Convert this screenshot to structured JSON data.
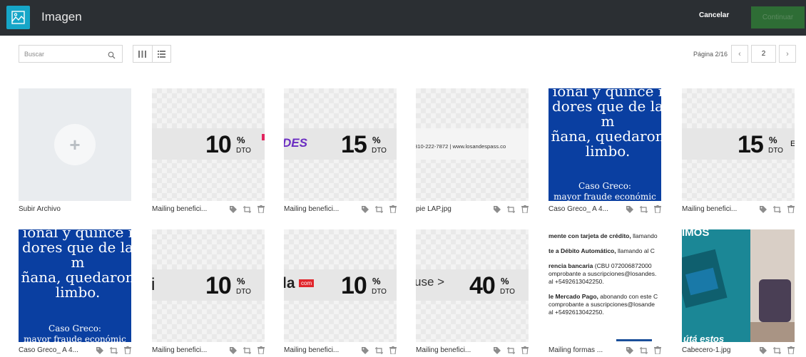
{
  "header": {
    "title": "Imagen",
    "cancel_label": "Cancelar",
    "continue_label": "Continuar",
    "logo_icon": "image-icon"
  },
  "toolbar": {
    "search_placeholder": "Buscar",
    "search_icon": "search-icon",
    "grid_view_icon": "grid-view-icon",
    "list_view_icon": "list-view-icon",
    "pagination_label": "Página 2/16",
    "page_value": "2",
    "prev_icon": "chevron-left-icon",
    "next_icon": "chevron-right-icon"
  },
  "tiles": [
    {
      "filename": "Subir Archivo"
    },
    {
      "filename": "Mailing benefici...",
      "percent": "10"
    },
    {
      "filename": "Mailing benefici...",
      "percent": "15",
      "brand": "DES"
    },
    {
      "filename": "pie LAP.jpg",
      "footer_text": "310-222-7872 | www.losandespass.co"
    },
    {
      "filename": "Caso Greco_ A 4...",
      "poem": [
        "ional y quince i",
        "dores que de la m",
        "ñana, quedaron",
        "limbo."
      ],
      "caption": [
        "Caso Greco:",
        "mayor fraude económic"
      ]
    },
    {
      "filename": "Mailing benefici...",
      "percent": "15"
    },
    {
      "filename": "Caso Greco_ A 4...",
      "poem": [
        "ional y quince i",
        "dores que de la m",
        "ñana, quedaron",
        "limbo."
      ],
      "caption": [
        "Caso Greco:",
        "mayor fraude económic"
      ]
    },
    {
      "filename": "Mailing benefici...",
      "percent": "10",
      "prefix": "i"
    },
    {
      "filename": "Mailing benefici...",
      "percent": "10",
      "brand": "la",
      "badge": "com"
    },
    {
      "filename": "Mailing benefici...",
      "percent": "40",
      "brand": "use >"
    },
    {
      "filename": "Mailing formas ...",
      "info_lines": [
        {
          "bold": "mente con tarjeta de crédito,",
          "rest": " llamando"
        },
        {
          "bold": "te a Débito Automático,",
          "rest": " llamando al C"
        },
        {
          "bold": "rencia bancaria",
          "rest": " (CBU 072006872000"
        },
        {
          "bold": "",
          "rest": "omprobante a suscripciones@losandes."
        },
        {
          "bold": "",
          "rest": "al +5492613042250."
        },
        {
          "bold": "le Mercado Pago,",
          "rest": " abonando con este C"
        },
        {
          "bold": "",
          "rest": "comprobante a suscripciones@losande"
        },
        {
          "bold": "",
          "rest": "al +5492613042250."
        }
      ]
    },
    {
      "filename": "Cabecero-1.jpg",
      "banner_top": "IMOS",
      "banner_bottom": "útá estos"
    }
  ],
  "labels": {
    "percent_symbol": "%",
    "dto": "DTO"
  },
  "colors": {
    "topbar": "#2b2f33",
    "accent": "#16a6c8",
    "continue": "#2e6d35",
    "blue_tile": "#0a3fa1"
  }
}
